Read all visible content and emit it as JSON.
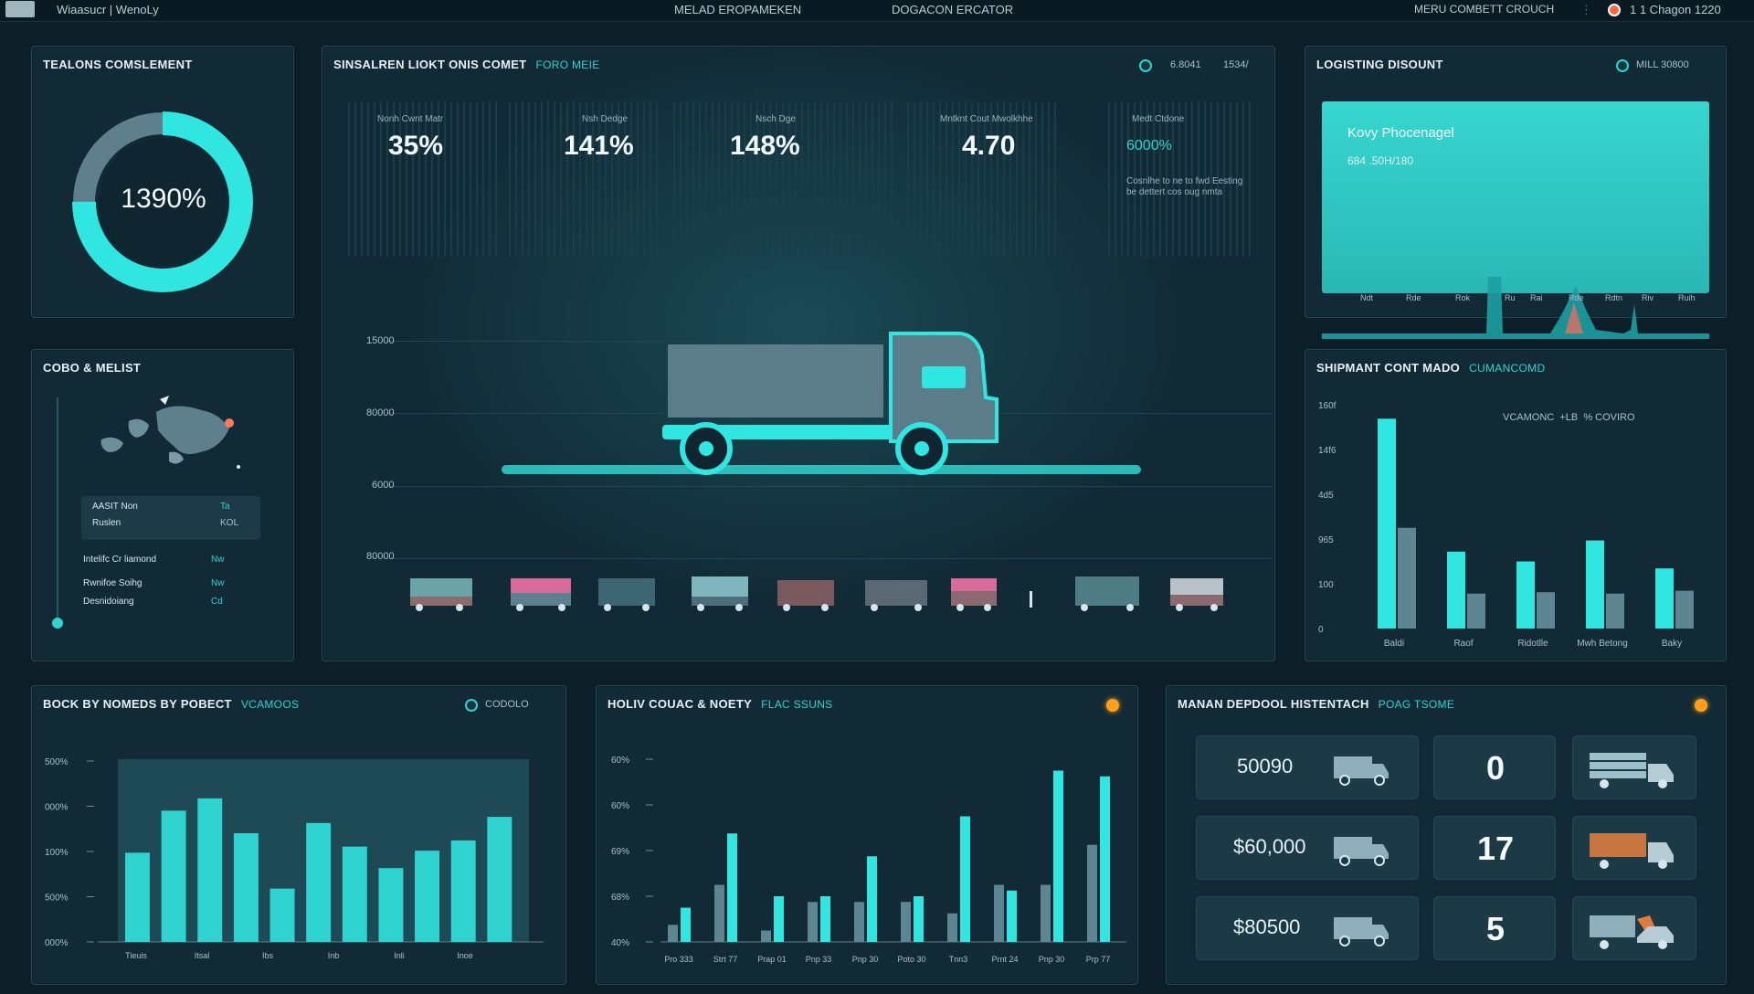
{
  "topbar": {
    "app_title": "Wiaasucr | WenoLy",
    "nav_1": "MELAD EROPAMEKEN",
    "nav_2": "DOGACON ERCATOR",
    "right_text": "MERU COMBETT CROUCH",
    "time": "1 1 Chagon 1220"
  },
  "gauge_panel": {
    "title": "TEALONS COMSLEMENT",
    "value_text": "1390%",
    "fill_fraction": 0.75,
    "colors": {
      "fill": "#2fe6e1",
      "track": "#5f7f8d"
    }
  },
  "map_panel": {
    "title": "COBO & MELIST",
    "highlight_row": {
      "label": "AASIT Non",
      "value": "Ta"
    },
    "highlight_row_2": {
      "label": "Ruslen",
      "value": "KOL"
    },
    "rows": [
      {
        "label": "Intelifc Cr liamond",
        "value": "Nw"
      },
      {
        "label": "Rwnifoe Soihg",
        "value": "Nw"
      },
      {
        "label": "Desnidoiang",
        "value": "Cd"
      }
    ]
  },
  "main_panel": {
    "title": "SINSALREN LIOKT ONIS COMET",
    "subtitle": "FORO MEIE",
    "header_right_1": "6.8041",
    "header_right_2": "1534/",
    "kpis": [
      {
        "label": "Nonh Cwnt Matr",
        "value": "35%"
      },
      {
        "label": "Nsh Dedge",
        "value": "141%"
      },
      {
        "label": "Nsch Dge",
        "value": "148%"
      },
      {
        "label": "Mntknt Cout Mwolkhhe",
        "value": "4.70"
      },
      {
        "label": "Medt Ctdone",
        "value": "6000%",
        "note": "Cosnlhe to ne to fwd Eesting be dettert cos oug nmta"
      }
    ],
    "y_labels": [
      "15000",
      "80000",
      "6000",
      "80000"
    ]
  },
  "logistics_panel": {
    "title": "LOGISTING DISOUNT",
    "right_label": "MILL 30800",
    "card_title": "Kovy Phocenagel",
    "card_sub": "684 .50H/180",
    "x_labels": [
      "Ndt",
      "Rde",
      "Rok",
      "Ru",
      "Rai",
      "Rde",
      "Rdtn",
      "Riv",
      "Ruih"
    ]
  },
  "shipment_panel": {
    "title": "SHIPMANT CONT MADO",
    "subtitle": "CUMANCOMD",
    "legend": "VCAMONC  +LB  % COVIRO",
    "chart_data": {
      "type": "bar",
      "categories": [
        "Baldi",
        "Raof",
        "Ridotlle",
        "Mwh Betong",
        "Baky"
      ],
      "series": [
        {
          "values": [
            150,
            55,
            48,
            63,
            43
          ]
        },
        {
          "values": [
            72,
            25,
            26,
            25,
            27
          ]
        }
      ],
      "y_tick_labels": [
        "160f",
        "14f6",
        "4d5",
        "965",
        "100",
        "0"
      ],
      "ylim": [
        0,
        160
      ]
    }
  },
  "block_panel": {
    "title": "BOCK BY NOMEDS BY POBECT",
    "subtitle": "VCAMOOS",
    "right_label": "CODOLO",
    "chart_data": {
      "type": "bar",
      "categories": [
        "Tieuis",
        "Itsal",
        "Ibs",
        "Inb",
        "Inli",
        "Inoe"
      ],
      "values": [
        435,
        640,
        700,
        530,
        260,
        580,
        465,
        360,
        445,
        495,
        610
      ],
      "y_tick_labels": [
        "500%",
        "000%",
        "100%",
        "500%",
        "000%"
      ],
      "ylim": [
        0,
        900
      ]
    }
  },
  "holiv_panel": {
    "title": "HOLIV COUAC & NOETY",
    "subtitle": "FLAC SSUNS",
    "chart_data": {
      "type": "bar",
      "categories": [
        "Pro 333",
        "Strt 77",
        "Prap 01",
        "Pnp 33",
        "Pnp 30",
        "Poto 30",
        "Tnn3",
        "Prnt 24",
        "Pnp 30",
        "Prp 77"
      ],
      "series": [
        {
          "values": [
            43,
            50,
            42,
            47,
            47,
            47,
            45,
            50,
            50,
            57
          ]
        },
        {
          "values": [
            46,
            59,
            48,
            48,
            55,
            48,
            62,
            49,
            70,
            69
          ]
        }
      ],
      "y_tick_labels": [
        "60%",
        "60%",
        "69%",
        "68%",
        "40%"
      ],
      "ylim": [
        40,
        72
      ]
    }
  },
  "manan_panel": {
    "title": "MANAN DEPDOOL HISTENTACH",
    "subtitle": "POAG TSOME",
    "tiles": [
      {
        "amount": "50090",
        "count": "0"
      },
      {
        "amount": "$60,000",
        "count": "17"
      },
      {
        "amount": "$80500",
        "count": "5"
      }
    ]
  }
}
